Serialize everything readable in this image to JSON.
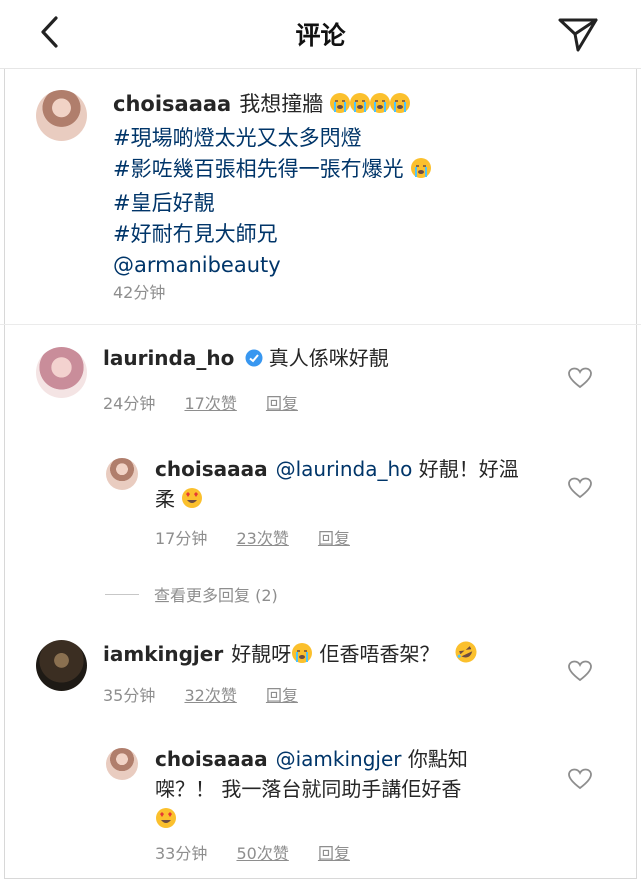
{
  "header": {
    "title": "评论",
    "back_icon": "chevron-left-icon",
    "send_icon": "paper-plane-icon"
  },
  "post": {
    "username": "choisaaaa",
    "lines": [
      "我想撞牆",
      "#現場啲燈太光又太多閃燈",
      "#影咗幾百張相先得一張冇爆光",
      "#皇后好靚",
      "#好耐冇見大師兄",
      "@armanibeauty"
    ],
    "time": "42分钟"
  },
  "comments": [
    {
      "username": "laurinda_ho",
      "verified": true,
      "text": "真人係咪好靚",
      "time": "24分钟",
      "likes": "17次赞",
      "reply": "回复"
    },
    {
      "username": "choisaaaa",
      "mention": "@laurinda_ho",
      "text_line1": "好靚！好溫",
      "text_line2": "柔",
      "time": "17分钟",
      "likes": "23次赞",
      "reply": "回复"
    },
    {
      "view_more": "查看更多回复 (2)"
    },
    {
      "username": "iamkingjer",
      "text_a": "好靚呀",
      "text_b": "佢香唔香架？",
      "time": "35分钟",
      "likes": "32次赞",
      "reply": "回复"
    },
    {
      "username": "choisaaaa",
      "mention": "@iamkingjer",
      "text_line1": "你點知",
      "text_line2": "㗎？！ 我一落台就同助手講佢好香",
      "time": "33分钟",
      "likes": "50次赞",
      "reply": "回复"
    }
  ],
  "colors": {
    "hashtag": "#003569",
    "meta": "#8e8e8e",
    "verified": "#3897f0"
  }
}
